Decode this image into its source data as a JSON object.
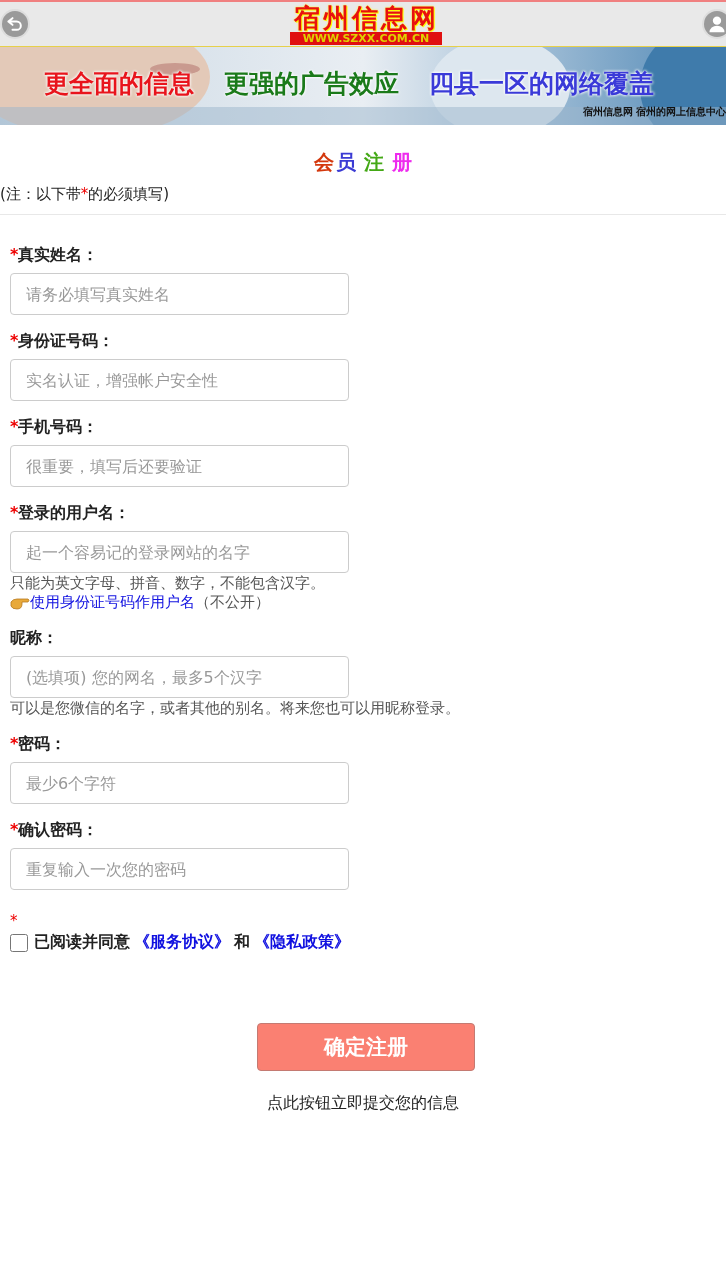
{
  "header": {
    "logo_title": "宿州信息网",
    "logo_url": "WWW.SZXX.COM.CN"
  },
  "banner": {
    "slogans": [
      {
        "text": "更全面的信息",
        "color": "#e8141c"
      },
      {
        "text": "更强的广告效应",
        "color": "#1a7a1a"
      },
      {
        "text": "四县一区的网络覆盖",
        "color": "#3a3ad8"
      }
    ],
    "caption": "宿州信息网 宿州的网上信息中心"
  },
  "page_title": [
    {
      "text": "会",
      "color": "#d4380d"
    },
    {
      "text": "员",
      "color": "#3b3bd4"
    },
    {
      "text": "注",
      "color": "#43a815"
    },
    {
      "text": "册",
      "color": "#ee2bee"
    }
  ],
  "note": {
    "before": "(注：以下带",
    "mark": "*",
    "after": "的必须填写)"
  },
  "required_mark": "*",
  "fields": [
    {
      "label": "真实姓名：",
      "required": true,
      "placeholder": "请务必填写真实姓名"
    },
    {
      "label": "身份证号码：",
      "required": true,
      "placeholder": "实名认证，增强帐户安全性"
    },
    {
      "label": "手机号码：",
      "required": true,
      "placeholder": "很重要，填写后还要验证"
    },
    {
      "label": "登录的用户名：",
      "required": true,
      "placeholder": "起一个容易记的登录网站的名字",
      "hint": "只能为英文字母、拼音、数字，不能包含汉字。",
      "link": "使用身份证号码作用户名",
      "link_suffix": "（不公开）"
    },
    {
      "label": "昵称：",
      "required": false,
      "placeholder": "(选填项) 您的网名，最多5个汉字",
      "hint": "可以是您微信的名字，或者其他的别名。将来您也可以用昵称登录。"
    },
    {
      "label": "密码：",
      "required": true,
      "placeholder": "最少6个字符"
    },
    {
      "label": "确认密码：",
      "required": true,
      "placeholder": "重复输入一次您的密码"
    }
  ],
  "agreement": {
    "required": true,
    "checked": false,
    "text": "已阅读并同意",
    "link_1": "《服务协议》",
    "between": "和",
    "link_2": "《隐私政策》"
  },
  "submit": {
    "label": "确定注册",
    "caption": "点此按钮立即提交您的信息"
  }
}
